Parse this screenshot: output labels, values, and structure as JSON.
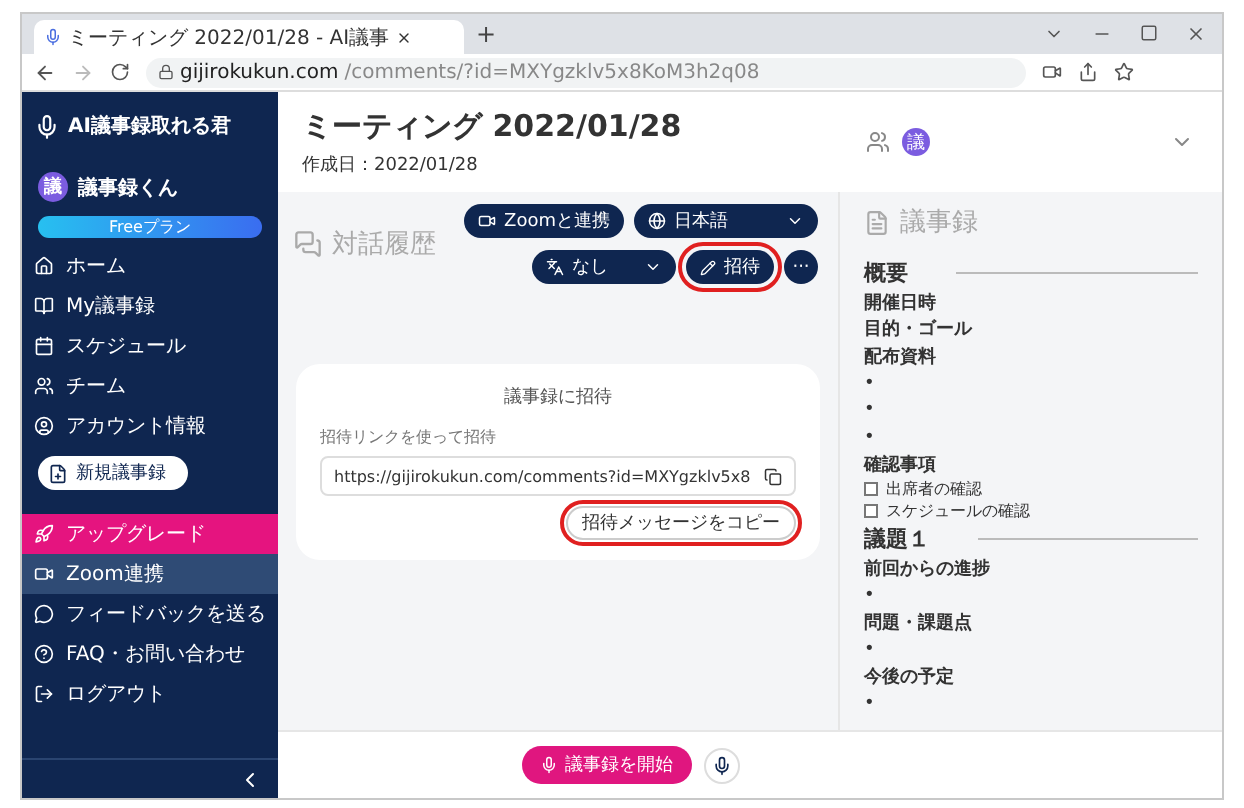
{
  "browser": {
    "tab_title": "ミーティング 2022/01/28 - AI議事",
    "new_tab": "+",
    "url_host": "gijirokukun.com",
    "url_path": "/comments/?id=MXYgzklv5x8KoM3h2q08"
  },
  "sidebar": {
    "logo": "AI議事録取れる君",
    "user": {
      "avatar": "議",
      "name": "議事録くん"
    },
    "plan": "Freeプラン",
    "items": [
      {
        "label": "ホーム",
        "selected": false
      },
      {
        "label": "My議事録",
        "selected": false
      },
      {
        "label": "スケジュール",
        "selected": false
      },
      {
        "label": "チーム",
        "selected": false
      },
      {
        "label": "アカウント情報",
        "selected": false
      }
    ],
    "new_button": "新規議事録",
    "upgrade": "アップグレード",
    "more_items": [
      {
        "label": "Zoom連携",
        "selected": true
      },
      {
        "label": "フィードバックを送る",
        "selected": false
      },
      {
        "label": "FAQ・お問い合わせ",
        "selected": false
      },
      {
        "label": "ログアウト",
        "selected": false
      }
    ]
  },
  "meeting": {
    "title": "ミーティング 2022/01/28",
    "created": "作成日：2022/01/28",
    "avatar": "議"
  },
  "conversation": {
    "heading": "対話履歴",
    "zoom_button": "Zoomと連携",
    "language": "日本語",
    "translation": "なし",
    "invite_button": {
      "label": "招待",
      "highlighted": true
    },
    "more": "···"
  },
  "invite_card": {
    "title": "議事録に招待",
    "caption": "招待リンクを使って招待",
    "link": "https://gijirokukun.com/comments?id=MXYgzklv5x8",
    "copy_button": {
      "label": "招待メッセージをコピー",
      "highlighted": true
    }
  },
  "start_button": "議事録を開始",
  "minutes": {
    "heading": "議事録",
    "lines": [
      {
        "kind": "section",
        "text": "概要"
      },
      {
        "kind": "item",
        "text": "開催日時"
      },
      {
        "kind": "item",
        "text": "目的・ゴール"
      },
      {
        "kind": "item",
        "text": "配布資料"
      },
      {
        "kind": "bullet",
        "text": "•"
      },
      {
        "kind": "bullet",
        "text": "•"
      },
      {
        "kind": "bullet",
        "text": "•"
      },
      {
        "kind": "item",
        "text": "確認事項"
      },
      {
        "kind": "check",
        "text": "出席者の確認",
        "checked": false
      },
      {
        "kind": "check",
        "text": "スケジュールの確認",
        "checked": false
      },
      {
        "kind": "section",
        "text": "議題１"
      },
      {
        "kind": "item",
        "text": "前回からの進捗"
      },
      {
        "kind": "bullet",
        "text": "•"
      },
      {
        "kind": "item",
        "text": "問題・課題点"
      },
      {
        "kind": "bullet",
        "text": "•"
      },
      {
        "kind": "item",
        "text": "今後の予定"
      },
      {
        "kind": "bullet",
        "text": "•"
      }
    ]
  }
}
